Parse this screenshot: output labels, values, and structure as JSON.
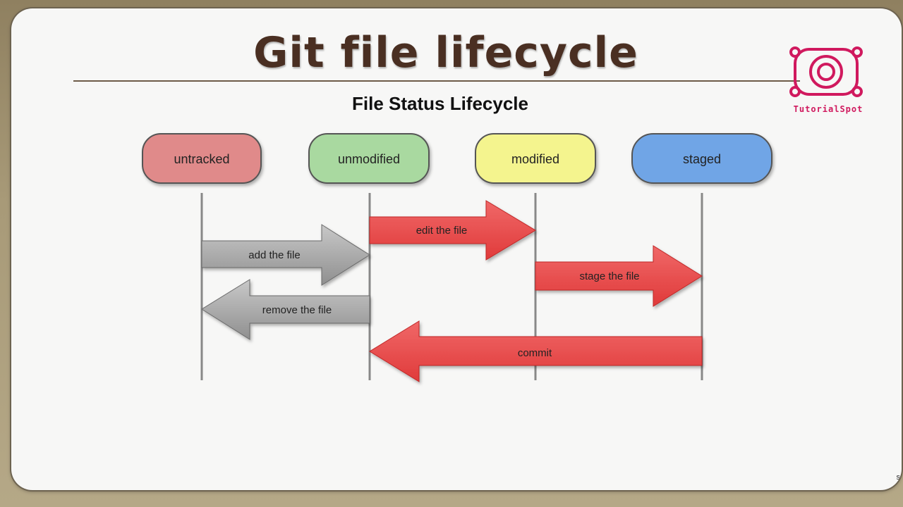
{
  "slide": {
    "title": "Git file lifecycle",
    "logo": {
      "text": "TutorialSpot",
      "icon": "tutorialspot-logo-icon",
      "color": "#d0195e"
    }
  },
  "diagram": {
    "title": "File Status Lifecycle",
    "states": [
      {
        "label": "untracked",
        "color": "#e08a8a"
      },
      {
        "label": "unmodified",
        "color": "#a9d9a0"
      },
      {
        "label": "modified",
        "color": "#f4f48e"
      },
      {
        "label": "staged",
        "color": "#6fa5e6"
      }
    ],
    "transitions": [
      {
        "label": "add the file",
        "from": "untracked",
        "to": "unmodified",
        "color": "gray"
      },
      {
        "label": "edit the file",
        "from": "unmodified",
        "to": "modified",
        "color": "red"
      },
      {
        "label": "stage the file",
        "from": "modified",
        "to": "staged",
        "color": "red"
      },
      {
        "label": "remove the file",
        "from": "unmodified",
        "to": "untracked",
        "color": "gray"
      },
      {
        "label": "commit",
        "from": "staged",
        "to": "unmodified",
        "color": "red"
      }
    ]
  },
  "footer": {
    "corner_text": "s"
  }
}
